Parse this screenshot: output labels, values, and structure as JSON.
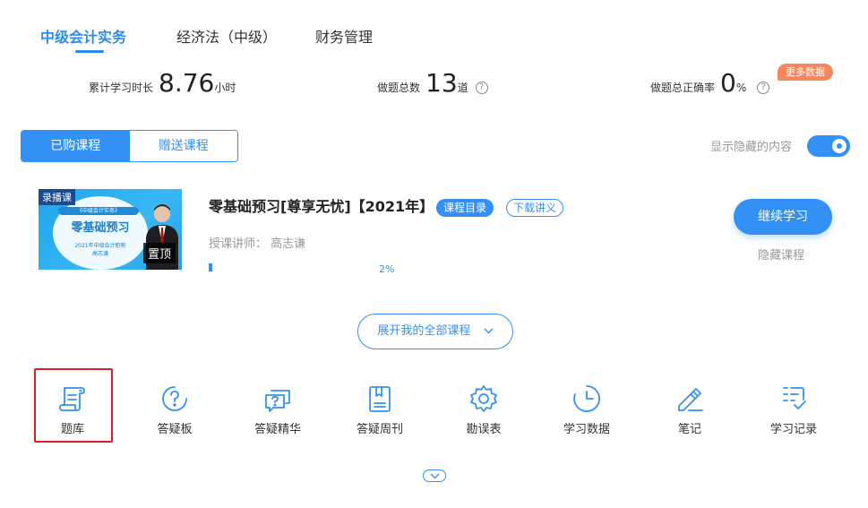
{
  "tabs": [
    {
      "label": "中级会计实务",
      "active": true
    },
    {
      "label": "经济法（中级）",
      "active": false
    },
    {
      "label": "财务管理",
      "active": false
    }
  ],
  "stats": {
    "study_time_label": "累计学习时长",
    "study_time_value": "8.76",
    "study_time_unit": "小时",
    "questions_label": "做题总数",
    "questions_value": "13",
    "questions_unit": "道",
    "accuracy_label": "做题总正确率",
    "accuracy_value": "0",
    "accuracy_unit": "%",
    "more_data": "更多数据",
    "help_glyph": "?"
  },
  "segment": {
    "purchased": "已购课程",
    "gifted": "赠送课程"
  },
  "toggle": {
    "label": "显示隐藏的内容",
    "on": true
  },
  "course": {
    "thumb_tag": "录播课",
    "thumb_line1": "《中级会计实务》",
    "thumb_line2": "零基础预习",
    "thumb_line3": "2021年中级会计职称",
    "thumb_line4": "高志谦",
    "pin_label": "置顶",
    "title": "零基础预习[尊享无忧]【2021年】",
    "catalog_label": "课程目录",
    "download_label": "下载讲义",
    "teacher": "授课讲师：  高志谦",
    "progress_percent": 2,
    "progress_text": "2%",
    "continue_label": "继续学习",
    "hide_label": "隐藏课程"
  },
  "expand": {
    "label": "展开我的全部课程"
  },
  "tools": [
    {
      "label": "题库",
      "icon": "scroll-icon"
    },
    {
      "label": "答疑板",
      "icon": "question-circle-icon"
    },
    {
      "label": "答疑精华",
      "icon": "chat-question-icon"
    },
    {
      "label": "答疑周刊",
      "icon": "bookmark-book-icon"
    },
    {
      "label": "勘误表",
      "icon": "gear-icon"
    },
    {
      "label": "学习数据",
      "icon": "clock-icon"
    },
    {
      "label": "笔记",
      "icon": "pencil-icon"
    },
    {
      "label": "学习记录",
      "icon": "checklist-icon"
    }
  ],
  "colors": {
    "accent": "#3391f5",
    "badge": "#f4875d",
    "highlight": "#e02020"
  }
}
